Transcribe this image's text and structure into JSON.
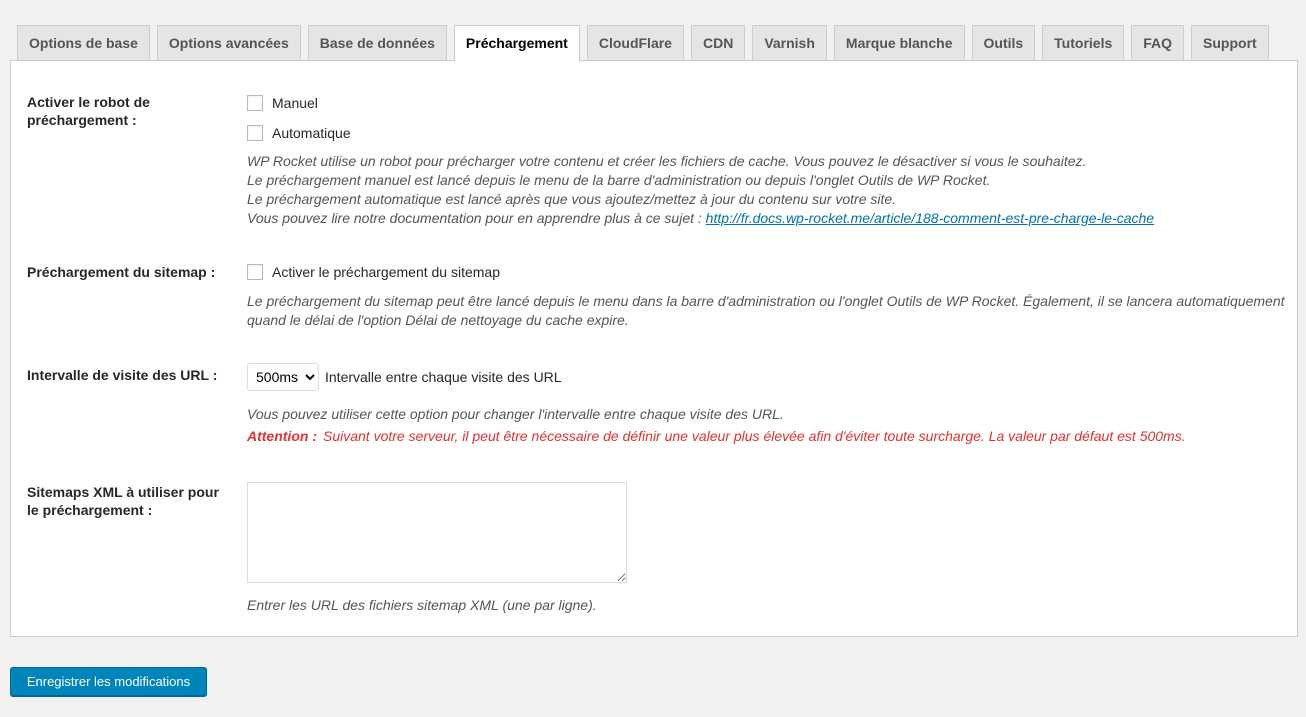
{
  "tabs": [
    "Options de base",
    "Options avancées",
    "Base de données",
    "Préchargement",
    "CloudFlare",
    "CDN",
    "Varnish",
    "Marque blanche",
    "Outils",
    "Tutoriels",
    "FAQ",
    "Support"
  ],
  "active_tab": "Préchargement",
  "robot": {
    "label": "Activer le robot de préchargement :",
    "opt_manual": "Manuel",
    "opt_auto": "Automatique",
    "desc1": "WP Rocket utilise un robot pour précharger votre contenu et créer les fichiers de cache. Vous pouvez le désactiver si vous le souhaitez.",
    "desc2": "Le préchargement manuel est lancé depuis le menu de la barre d'administration ou depuis l'onglet Outils de WP Rocket.",
    "desc3": "Le préchargement automatique est lancé après que vous ajoutez/mettez à jour du contenu sur votre site.",
    "desc4": "Vous pouvez lire notre documentation pour en apprendre plus à ce sujet : ",
    "link": "http://fr.docs.wp-rocket.me/article/188-comment-est-pre-charge-le-cache"
  },
  "sitemap": {
    "label": "Préchargement du sitemap :",
    "opt": "Activer le préchargement du sitemap",
    "desc": "Le préchargement du sitemap peut être lancé depuis le menu dans la barre d'administration ou l'onglet Outils de WP Rocket. Également, il se lancera automatiquement quand le délai de l'option Délai de nettoyage du cache expire."
  },
  "interval": {
    "label": "Intervalle de visite des URL :",
    "value": "500ms",
    "after": "Intervalle entre chaque visite des URL",
    "desc": "Vous pouvez utiliser cette option pour changer l'intervalle entre chaque visite des URL.",
    "warn_label": "Attention :",
    "warn": "Suivant votre serveur, il peut être nécessaire de définir une valeur plus élevée afin d'éviter toute surcharge. La valeur par défaut est 500ms."
  },
  "xml": {
    "label": "Sitemaps XML à utiliser pour le préchargement :",
    "value": "",
    "desc": "Entrer les URL des fichiers sitemap XML (une par ligne)."
  },
  "save_label": "Enregistrer les modifications"
}
